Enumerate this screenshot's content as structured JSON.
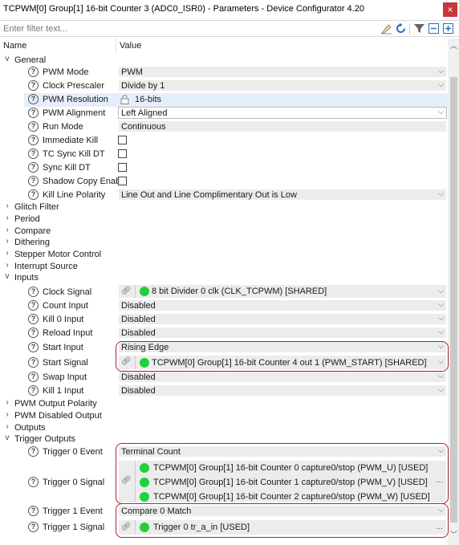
{
  "window": {
    "title": "TCPWM[0] Group[1] 16-bit Counter 3 (ADC0_ISR0) - Parameters - Device Configurator 4.20",
    "close_label": "×"
  },
  "filter": {
    "placeholder": "Enter filter text..."
  },
  "columns": {
    "name": "Name",
    "value": "Value"
  },
  "groups": {
    "general": "General",
    "glitch_filter": "Glitch Filter",
    "period": "Period",
    "compare": "Compare",
    "dithering": "Dithering",
    "stepper": "Stepper Motor Control",
    "interrupt": "Interrupt Source",
    "inputs": "Inputs",
    "pwm_output_polarity": "PWM Output Polarity",
    "pwm_disabled_output": "PWM Disabled Output",
    "outputs": "Outputs",
    "trigger_outputs": "Trigger Outputs"
  },
  "general": {
    "pwm_mode": {
      "label": "PWM Mode",
      "value": "PWM"
    },
    "clock_prescaler": {
      "label": "Clock Prescaler",
      "value": "Divide by 1"
    },
    "pwm_resolution": {
      "label": "PWM Resolution",
      "value": "16-bits"
    },
    "pwm_alignment": {
      "label": "PWM Alignment",
      "value": "Left Aligned"
    },
    "run_mode": {
      "label": "Run Mode",
      "value": "Continuous"
    },
    "immediate_kill": {
      "label": "Immediate Kill"
    },
    "tc_sync_kill": {
      "label": "TC Sync Kill DT"
    },
    "sync_kill": {
      "label": "Sync Kill DT"
    },
    "shadow_copy": {
      "label": "Shadow Copy Enable"
    },
    "kill_line_polarity": {
      "label": "Kill Line Polarity",
      "value": "Line Out and Line Complimentary Out is Low"
    }
  },
  "inputs": {
    "clock_signal": {
      "label": "Clock Signal",
      "value": "8 bit Divider 0 clk (CLK_TCPWM) [SHARED]"
    },
    "count_input": {
      "label": "Count Input",
      "value": "Disabled"
    },
    "kill0_input": {
      "label": "Kill 0 Input",
      "value": "Disabled"
    },
    "reload_input": {
      "label": "Reload Input",
      "value": "Disabled"
    },
    "start_input": {
      "label": "Start Input",
      "value": "Rising Edge"
    },
    "start_signal": {
      "label": "Start Signal",
      "value": "TCPWM[0] Group[1] 16-bit Counter 4 out 1 (PWM_START) [SHARED]"
    },
    "swap_input": {
      "label": "Swap Input",
      "value": "Disabled"
    },
    "kill1_input": {
      "label": "Kill 1 Input",
      "value": "Disabled"
    }
  },
  "trigger_outputs": {
    "trigger0_event": {
      "label": "Trigger 0 Event",
      "value": "Terminal Count"
    },
    "trigger0_signal": {
      "label": "Trigger 0 Signal",
      "values": [
        "TCPWM[0] Group[1] 16-bit Counter 0 capture0/stop (PWM_U) [USED]",
        "TCPWM[0] Group[1] 16-bit Counter 1 capture0/stop (PWM_V) [USED]",
        "TCPWM[0] Group[1] 16-bit Counter 2 capture0/stop (PWM_W) [USED]"
      ],
      "more": "..."
    },
    "trigger1_event": {
      "label": "Trigger 1 Event",
      "value": "Compare 0 Match"
    },
    "trigger1_signal": {
      "label": "Trigger 1 Signal",
      "value": "Trigger 0 tr_a_in [USED]",
      "more": "..."
    }
  },
  "icons": {
    "help": "?",
    "dropdown": "chevron-down-icon",
    "link": "link-icon",
    "status_ok_color": "#1fd13a",
    "highlight_color": "#b02230"
  }
}
